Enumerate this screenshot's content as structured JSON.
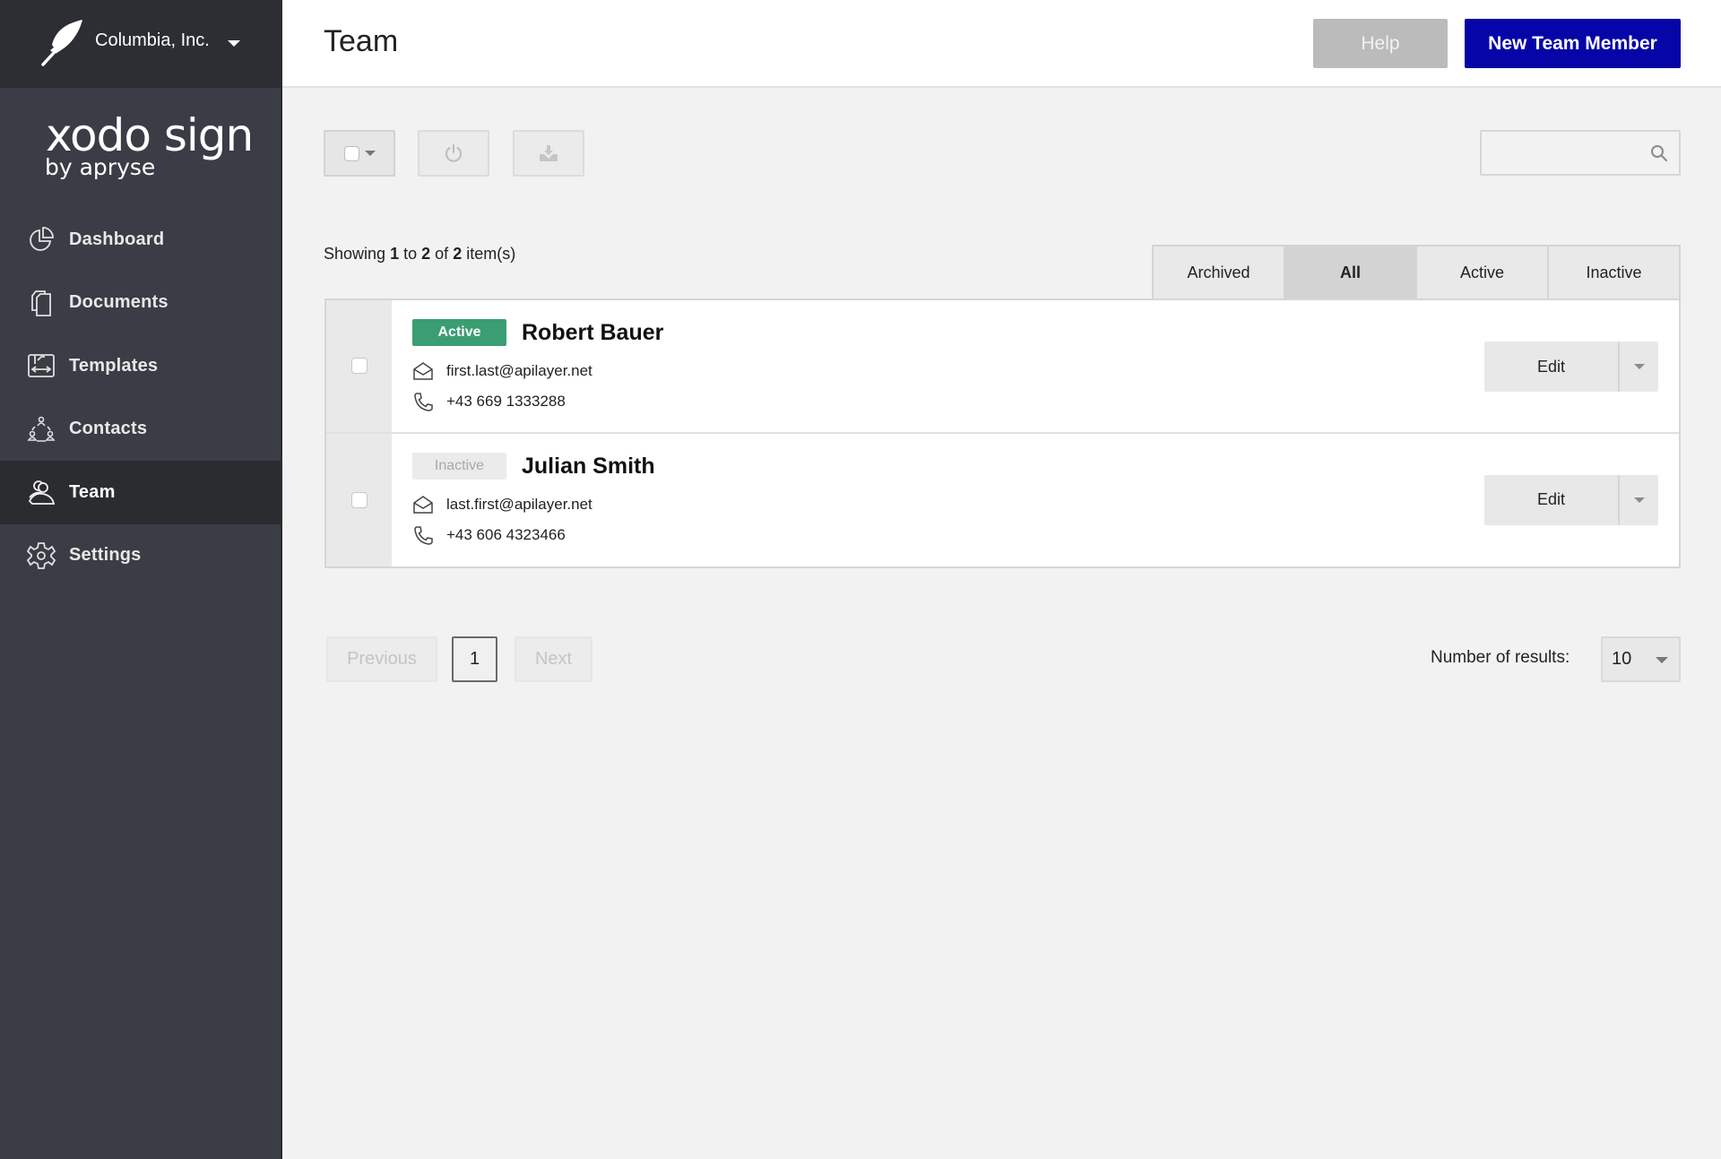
{
  "org": {
    "name": "Columbia, Inc.",
    "logo_icon": "feather-icon"
  },
  "brand": {
    "name": "xodo sign",
    "sub": "by apryse"
  },
  "sidebar": {
    "items": [
      {
        "label": "Dashboard",
        "icon": "pie-chart-icon",
        "active": false
      },
      {
        "label": "Documents",
        "icon": "documents-icon",
        "active": false
      },
      {
        "label": "Templates",
        "icon": "template-icon",
        "active": false
      },
      {
        "label": "Contacts",
        "icon": "contacts-icon",
        "active": false
      },
      {
        "label": "Team",
        "icon": "team-icon",
        "active": true
      },
      {
        "label": "Settings",
        "icon": "gear-icon",
        "active": false
      }
    ]
  },
  "header": {
    "title": "Team",
    "help_label": "Help",
    "new_member_label": "New Team Member"
  },
  "toolbar": {
    "select_icon": "checkbox-dropdown-icon",
    "power_icon": "power-icon",
    "download_icon": "download-icon",
    "search_placeholder": ""
  },
  "showing": {
    "prefix": "Showing",
    "from": "1",
    "to_word": "to",
    "to": "2",
    "of_word": "of",
    "total": "2",
    "suffix": "item(s)"
  },
  "tabs": [
    {
      "label": "Archived",
      "active": false
    },
    {
      "label": "All",
      "active": true
    },
    {
      "label": "Active",
      "active": false
    },
    {
      "label": "Inactive",
      "active": false
    }
  ],
  "members": [
    {
      "status": "Active",
      "name": "Robert Bauer",
      "email": "first.last@apilayer.net",
      "phone": "+43 669 1333288",
      "edit_label": "Edit"
    },
    {
      "status": "Inactive",
      "name": "Julian Smith",
      "email": "last.first@apilayer.net",
      "phone": "+43 606 4323466",
      "edit_label": "Edit"
    }
  ],
  "pagination": {
    "previous": "Previous",
    "current_page": "1",
    "next": "Next"
  },
  "results": {
    "label": "Number of results:",
    "value": "10"
  },
  "colors": {
    "accent": "#0606a8",
    "active_badge": "#3a9e72",
    "sidebar_bg": "#3a3d45"
  }
}
